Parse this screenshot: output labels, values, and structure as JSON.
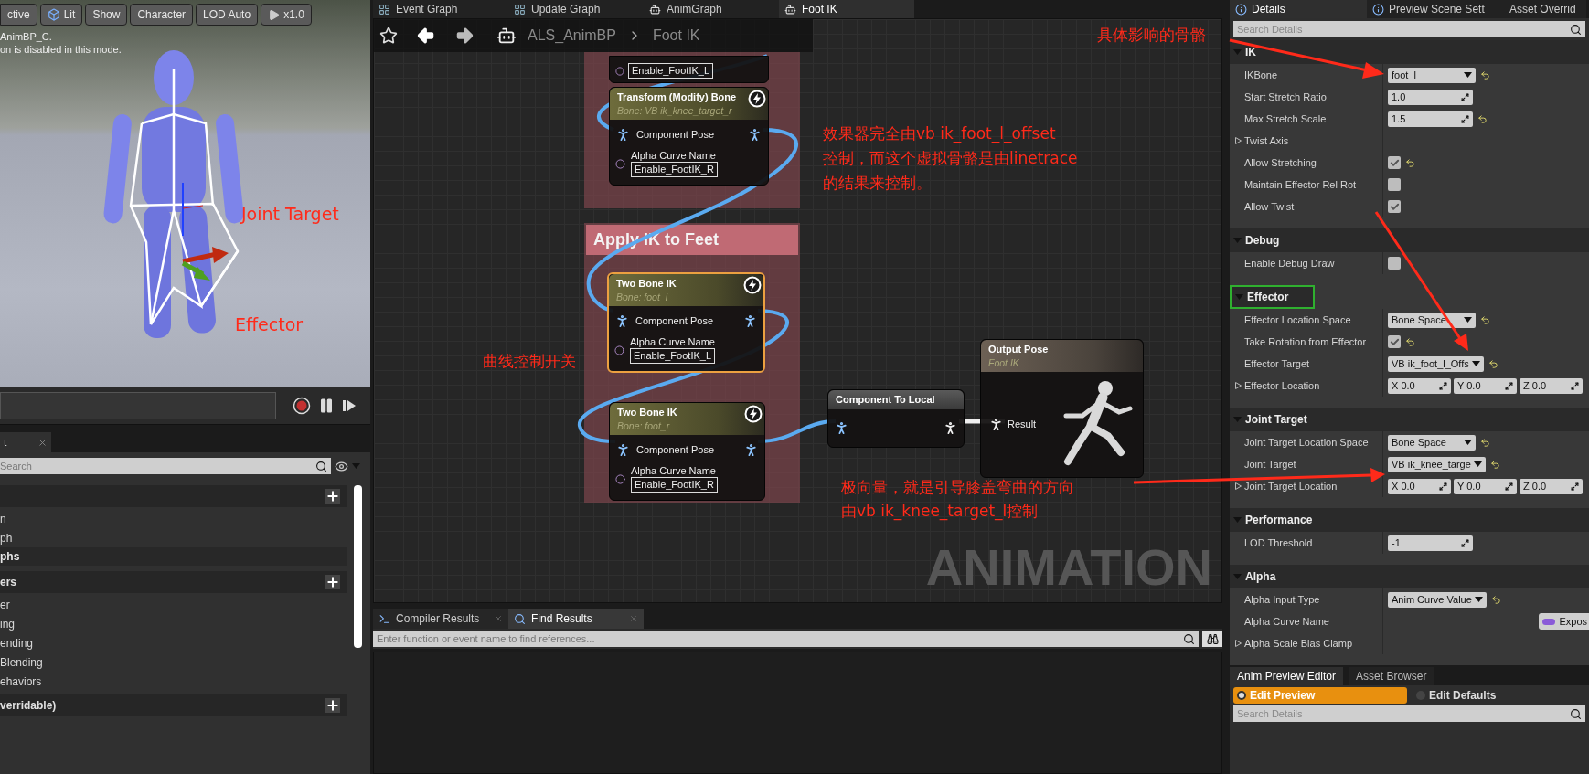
{
  "viewport": {
    "toolbar": [
      {
        "label": "ctive"
      },
      {
        "label": "Lit"
      },
      {
        "label": "Show"
      },
      {
        "label": "Character"
      },
      {
        "label": "LOD Auto"
      },
      {
        "label": "x1.0"
      }
    ],
    "overlay_lines": [
      "AnimBP_C.",
      "on is disabled in this mode."
    ]
  },
  "left_panel": {
    "tab": {
      "label": "t"
    },
    "search": {
      "placeholder": "Search"
    },
    "rows": [
      {
        "kind": "header"
      },
      {
        "kind": "item",
        "label": "n"
      },
      {
        "kind": "item",
        "label": "ph"
      },
      {
        "kind": "category",
        "label": "phs"
      },
      {
        "kind": "header",
        "label": "ers"
      },
      {
        "kind": "item",
        "label": "er"
      },
      {
        "kind": "item",
        "label": "ing"
      },
      {
        "kind": "item",
        "label": "ending"
      },
      {
        "kind": "item",
        "label": "Blending"
      },
      {
        "kind": "item",
        "label": "ehaviors"
      },
      {
        "kind": "header",
        "label": "verridable)"
      }
    ]
  },
  "graph_tabs": [
    {
      "label": "Event Graph",
      "selected": false
    },
    {
      "label": "Update Graph",
      "selected": false
    },
    {
      "label": "AnimGraph",
      "selected": false
    },
    {
      "label": "Foot IK",
      "selected": true
    }
  ],
  "breadcrumb": [
    "ALS_AnimBP",
    "Foot IK"
  ],
  "comments": [
    {
      "kind": "plain"
    },
    {
      "kind": "titled",
      "title": "Apply IK to Feet"
    }
  ],
  "nodes": [
    {
      "kind": "cut_off",
      "selected": false,
      "pins": [
        {
          "kind": "curve",
          "field": "Enable_FootIK_L"
        }
      ]
    },
    {
      "kind": "skeletal_control",
      "title": "Transform (Modify) Bone",
      "subtitle": "Bone: VB ik_knee_target_r",
      "selected": false,
      "pins": [
        {
          "kind": "pose",
          "label": "Component Pose"
        },
        {
          "kind": "curve",
          "label": "Alpha Curve Name",
          "field": "Enable_FootIK_R"
        }
      ]
    },
    {
      "kind": "skeletal_control",
      "title": "Two Bone IK",
      "subtitle": "Bone: foot_l",
      "selected": true,
      "pins": [
        {
          "kind": "pose",
          "label": "Component Pose"
        },
        {
          "kind": "curve",
          "label": "Alpha Curve Name",
          "field": "Enable_FootIK_L"
        }
      ]
    },
    {
      "kind": "skeletal_control",
      "title": "Two Bone IK",
      "subtitle": "Bone: foot_r",
      "selected": false,
      "pins": [
        {
          "kind": "pose",
          "label": "Component Pose"
        },
        {
          "kind": "curve",
          "label": "Alpha Curve Name",
          "field": "Enable_FootIK_R"
        }
      ]
    },
    {
      "kind": "conversion",
      "title": "Component To Local",
      "selected": false,
      "pins": [
        {
          "kind": "pose_through"
        }
      ]
    },
    {
      "kind": "output",
      "title": "Output Pose",
      "subtitle": "Foot IK",
      "selected": false,
      "pins": [
        {
          "kind": "pose",
          "label": "Result"
        }
      ]
    }
  ],
  "graph_watermark": "ANIMATION",
  "bottom_tabs": [
    {
      "label": "Compiler Results",
      "selected": false
    },
    {
      "label": "Find Results",
      "selected": true
    }
  ],
  "find": {
    "placeholder": "Enter function or event name to find references..."
  },
  "details": {
    "tabs": [
      {
        "label": "Details",
        "selected": true
      },
      {
        "label": "Preview Scene Sett",
        "selected": false
      },
      {
        "label": "Asset Overrid",
        "selected": false
      }
    ],
    "search": {
      "placeholder": "Search Details"
    },
    "sections": [
      {
        "title": "IK",
        "highlighted": false,
        "rows": [
          {
            "kind": "dropdown",
            "label": "IKBone",
            "value": "foot_l",
            "reset": true
          },
          {
            "kind": "number",
            "label": "Start Stretch Ratio",
            "value": "1.0",
            "reset": false
          },
          {
            "kind": "number",
            "label": "Max Stretch Scale",
            "value": "1.5",
            "reset": true
          },
          {
            "kind": "group",
            "label": "Twist Axis",
            "expanded": false
          },
          {
            "kind": "checkbox",
            "label": "Allow Stretching",
            "checked": true,
            "reset": true
          },
          {
            "kind": "checkbox",
            "label": "Maintain Effector Rel Rot",
            "checked": false,
            "reset": false
          },
          {
            "kind": "checkbox",
            "label": "Allow Twist",
            "checked": true,
            "reset": false
          }
        ]
      },
      {
        "title": "Debug",
        "highlighted": false,
        "rows": [
          {
            "kind": "checkbox",
            "label": "Enable Debug Draw",
            "checked": false,
            "reset": false
          }
        ]
      },
      {
        "title": "Effector",
        "highlighted": true,
        "rows": [
          {
            "kind": "dropdown",
            "label": "Effector Location Space",
            "value": "Bone Space",
            "reset": true
          },
          {
            "kind": "checkbox",
            "label": "Take Rotation from Effector",
            "checked": true,
            "reset": true
          },
          {
            "kind": "dropdown",
            "label": "Effector Target",
            "value": "VB ik_foot_l_Offs",
            "reset": true
          },
          {
            "kind": "vector",
            "label": "Effector Location",
            "expanded": false,
            "values": [
              {
                "axis": "X",
                "value": "0.0"
              },
              {
                "axis": "Y",
                "value": "0.0"
              },
              {
                "axis": "Z",
                "value": "0.0"
              }
            ]
          }
        ]
      },
      {
        "title": "Joint Target",
        "highlighted": false,
        "rows": [
          {
            "kind": "dropdown",
            "label": "Joint Target Location Space",
            "value": "Bone Space",
            "reset": true
          },
          {
            "kind": "dropdown",
            "label": "Joint Target",
            "value": "VB ik_knee_targe",
            "reset": true
          },
          {
            "kind": "vector",
            "label": "Joint Target Location",
            "expanded": false,
            "values": [
              {
                "axis": "X",
                "value": "0.0"
              },
              {
                "axis": "Y",
                "value": "0.0"
              },
              {
                "axis": "Z",
                "value": "0.0"
              }
            ]
          }
        ]
      },
      {
        "title": "Performance",
        "highlighted": false,
        "rows": [
          {
            "kind": "number",
            "label": "LOD Threshold",
            "value": "-1",
            "reset": false
          }
        ]
      },
      {
        "title": "Alpha",
        "highlighted": false,
        "rows": [
          {
            "kind": "dropdown",
            "label": "Alpha Input Type",
            "value": "Anim Curve Value",
            "reset": true
          },
          {
            "kind": "exposed_pin",
            "label": "Alpha Curve Name",
            "button": "Expos"
          },
          {
            "kind": "group",
            "label": "Alpha Scale Bias Clamp",
            "expanded": false
          }
        ]
      }
    ]
  },
  "preview": {
    "tabs": [
      {
        "label": "Anim Preview Editor",
        "selected": true
      },
      {
        "label": "Asset Browser",
        "selected": false
      }
    ],
    "modes": [
      {
        "label": "Edit Preview",
        "selected": true
      },
      {
        "label": "Edit Defaults",
        "selected": false
      }
    ],
    "search": {
      "placeholder": "Search Details"
    }
  },
  "annotations": [
    {
      "lines": [
        "具体影响的骨骼"
      ]
    },
    {
      "lines": [
        "效果器完全由vb ik_foot_l_offset",
        "控制，而这个虚拟骨骼是由linetrace",
        "的结果来控制。"
      ]
    },
    {
      "lines": [
        "曲线控制开关"
      ]
    },
    {
      "lines": [
        "极向量，就是引导膝盖弯曲的方向",
        "由vb ik_knee_target_l控制"
      ]
    },
    {
      "lines": [
        "Joint Target"
      ]
    },
    {
      "lines": [
        "Effector"
      ]
    }
  ]
}
